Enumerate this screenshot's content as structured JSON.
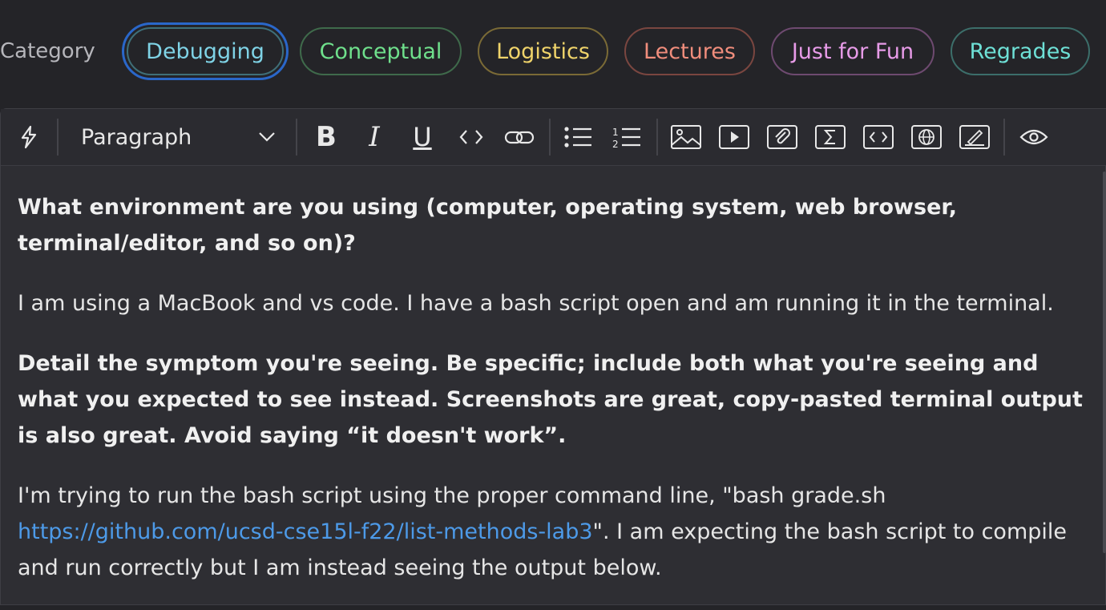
{
  "category": {
    "label": "Category",
    "pills": [
      {
        "label": "Debugging",
        "color": "#7fd3e6",
        "border": "#3f6f78",
        "selected": true
      },
      {
        "label": "Conceptual",
        "color": "#6fe08c",
        "border": "#3f6a4b"
      },
      {
        "label": "Logistics",
        "color": "#efd36a",
        "border": "#7a6a36"
      },
      {
        "label": "Lectures",
        "color": "#f08d7c",
        "border": "#7a4640"
      },
      {
        "label": "Just for Fun",
        "color": "#e79be8",
        "border": "#6e4a70"
      },
      {
        "label": "Regrades",
        "color": "#6ee0d6",
        "border": "#3c6e6a"
      }
    ]
  },
  "toolbar": {
    "block_type": "Paragraph",
    "icons": [
      "lightning-icon",
      "bold-icon",
      "italic-icon",
      "underline-icon",
      "inline-code-icon",
      "link-icon",
      "bullet-list-icon",
      "numbered-list-icon",
      "image-icon",
      "video-icon",
      "attachment-icon",
      "math-icon",
      "code-block-icon",
      "web-embed-icon",
      "drawing-icon",
      "preview-icon"
    ]
  },
  "content": {
    "q1": "What environment are you using (computer, operating system, web browser, terminal/editor, and so on)?",
    "a1": "I am using a MacBook and vs code. I have a bash script open and am running it in the terminal.",
    "q2": "Detail the symptom you're seeing. Be specific; include both what you're seeing and what you expected to see instead. Screenshots are great, copy-pasted terminal output is also great. Avoid saying “it doesn't work”.",
    "a2_before": "I'm trying to run the bash script using the proper command line, \"bash grade.sh ",
    "a2_link": "https://github.com/ucsd-cse15l-f22/list-methods-lab3",
    "a2_after": "\". I am expecting the bash script to compile and run correctly but I am instead seeing the output below."
  }
}
